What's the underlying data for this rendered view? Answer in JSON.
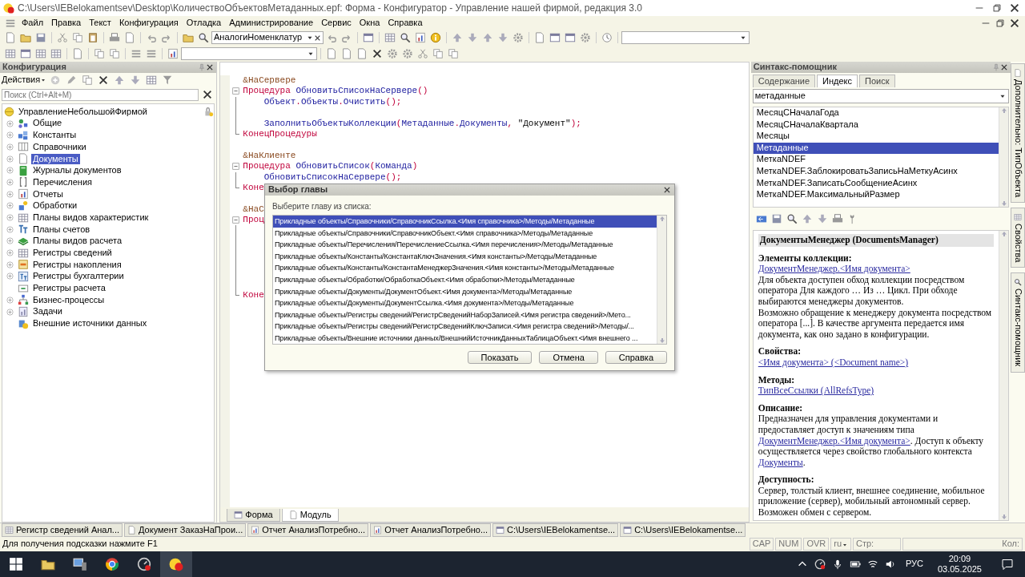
{
  "window": {
    "title": "C:\\Users\\IEBelokamentsev\\Desktop\\КоличествоОбъектовМетаданных.epf: Форма - Конфигуратор - Управление нашей фирмой, редакция 3.0"
  },
  "menu": [
    "Файл",
    "Правка",
    "Текст",
    "Конфигурация",
    "Отладка",
    "Администрирование",
    "Сервис",
    "Окна",
    "Справка"
  ],
  "toolbar": {
    "search_value": "АналогиНоменклатур"
  },
  "config_panel": {
    "title": "Конфигурация",
    "actions_label": "Действия",
    "search": {
      "placeholder": "Поиск (Ctrl+Alt+M)"
    },
    "tree": [
      {
        "label": "УправлениеНебольшойФирмой",
        "selected": false,
        "children": [
          {
            "label": "Общие",
            "expandable": true,
            "selected": false
          },
          {
            "label": "Константы",
            "expandable": true,
            "selected": false
          },
          {
            "label": "Справочники",
            "expandable": true,
            "selected": false
          },
          {
            "label": "Документы",
            "expandable": true,
            "selected": true
          },
          {
            "label": "Журналы документов",
            "expandable": true,
            "selected": false
          },
          {
            "label": "Перечисления",
            "expandable": true,
            "selected": false
          },
          {
            "label": "Отчеты",
            "expandable": true,
            "selected": false
          },
          {
            "label": "Обработки",
            "expandable": true,
            "selected": false
          },
          {
            "label": "Планы видов характеристик",
            "expandable": true,
            "selected": false
          },
          {
            "label": "Планы счетов",
            "expandable": true,
            "selected": false
          },
          {
            "label": "Планы видов расчета",
            "expandable": true,
            "selected": false
          },
          {
            "label": "Регистры сведений",
            "expandable": true,
            "selected": false
          },
          {
            "label": "Регистры накопления",
            "expandable": true,
            "selected": false
          },
          {
            "label": "Регистры бухгалтерии",
            "expandable": true,
            "selected": false
          },
          {
            "label": "Регистры расчета",
            "expandable": false,
            "selected": false
          },
          {
            "label": "Бизнес-процессы",
            "expandable": true,
            "selected": false
          },
          {
            "label": "Задачи",
            "expandable": true,
            "selected": false
          },
          {
            "label": "Внешние источники данных",
            "expandable": false,
            "selected": false
          }
        ]
      }
    ]
  },
  "editor": {
    "lines": [
      {
        "kind": "code",
        "fold_start": false,
        "in_fold": false,
        "fold_end": false,
        "indented": false,
        "tokens": [
          {
            "kind": "directive",
            "text": "&НаСервере"
          }
        ]
      },
      {
        "kind": "code",
        "fold_start": true,
        "in_fold": false,
        "fold_end": false,
        "indented": false,
        "tokens": [
          {
            "kind": "keyword",
            "text": "Процедура "
          },
          {
            "kind": "ident",
            "text": "ОбновитьСписокНаСервере"
          },
          {
            "kind": "punct",
            "text": "()"
          }
        ]
      },
      {
        "kind": "code",
        "fold_start": false,
        "in_fold": true,
        "fold_end": false,
        "indented": true,
        "tokens": [
          {
            "kind": "ident",
            "text": "Объект"
          },
          {
            "kind": "punct",
            "text": "."
          },
          {
            "kind": "ident",
            "text": "Объекты"
          },
          {
            "kind": "punct",
            "text": "."
          },
          {
            "kind": "ident",
            "text": "Очистить"
          },
          {
            "kind": "punct",
            "text": "();"
          }
        ]
      },
      {
        "kind": "blank",
        "fold_start": false,
        "in_fold": true,
        "fold_end": false
      },
      {
        "kind": "code",
        "fold_start": false,
        "in_fold": true,
        "fold_end": false,
        "indented": true,
        "tokens": [
          {
            "kind": "ident",
            "text": "ЗаполнитьОбъектыКоллекции"
          },
          {
            "kind": "punct",
            "text": "("
          },
          {
            "kind": "ident",
            "text": "Метаданные"
          },
          {
            "kind": "punct",
            "text": "."
          },
          {
            "kind": "ident",
            "text": "Документы"
          },
          {
            "kind": "punct",
            "text": ", "
          },
          {
            "kind": "string",
            "text": "\"Документ\""
          },
          {
            "kind": "punct",
            "text": ");"
          }
        ]
      },
      {
        "kind": "code",
        "fold_start": false,
        "in_fold": false,
        "fold_end": true,
        "indented": false,
        "tokens": [
          {
            "kind": "keyword",
            "text": "КонецПроцедуры"
          }
        ]
      },
      {
        "kind": "blank",
        "fold_start": false,
        "in_fold": false,
        "fold_end": false
      },
      {
        "kind": "code",
        "fold_start": false,
        "in_fold": false,
        "fold_end": false,
        "indented": false,
        "tokens": [
          {
            "kind": "directive",
            "text": "&НаКлиенте"
          }
        ]
      },
      {
        "kind": "code",
        "fold_start": true,
        "in_fold": false,
        "fold_end": false,
        "indented": false,
        "tokens": [
          {
            "kind": "keyword",
            "text": "Процедура "
          },
          {
            "kind": "ident",
            "text": "ОбновитьСписок"
          },
          {
            "kind": "punct",
            "text": "("
          },
          {
            "kind": "ident",
            "text": "Команда"
          },
          {
            "kind": "punct",
            "text": ")"
          }
        ]
      },
      {
        "kind": "code",
        "fold_start": false,
        "in_fold": true,
        "fold_end": false,
        "indented": true,
        "tokens": [
          {
            "kind": "ident",
            "text": "ОбновитьСписокНаСервере"
          },
          {
            "kind": "punct",
            "text": "();"
          }
        ]
      },
      {
        "kind": "code",
        "fold_start": false,
        "in_fold": false,
        "fold_end": true,
        "indented": false,
        "tokens": [
          {
            "kind": "keyword",
            "text": "Коне"
          }
        ]
      },
      {
        "kind": "blank",
        "fold_start": false,
        "in_fold": false,
        "fold_end": false
      },
      {
        "kind": "code",
        "fold_start": false,
        "in_fold": false,
        "fold_end": false,
        "indented": false,
        "tokens": [
          {
            "kind": "directive",
            "text": "&НаС"
          }
        ]
      },
      {
        "kind": "code",
        "fold_start": true,
        "in_fold": false,
        "fold_end": false,
        "indented": false,
        "tokens": [
          {
            "kind": "keyword",
            "text": "Проц"
          }
        ]
      },
      {
        "kind": "blank",
        "fold_start": false,
        "in_fold": true,
        "fold_end": false
      },
      {
        "kind": "blank",
        "fold_start": false,
        "in_fold": true,
        "fold_end": false
      },
      {
        "kind": "blank",
        "fold_start": false,
        "in_fold": true,
        "fold_end": false
      },
      {
        "kind": "blank",
        "fold_start": false,
        "in_fold": true,
        "fold_end": false
      },
      {
        "kind": "blank",
        "fold_start": false,
        "in_fold": true,
        "fold_end": false
      },
      {
        "kind": "blank",
        "fold_start": false,
        "in_fold": true,
        "fold_end": false
      },
      {
        "kind": "code",
        "fold_start": false,
        "in_fold": false,
        "fold_end": true,
        "indented": false,
        "tokens": [
          {
            "kind": "keyword",
            "text": "Коне"
          }
        ]
      }
    ],
    "tabs": [
      {
        "label": "Форма",
        "selected": false
      },
      {
        "label": "Модуль",
        "selected": true
      }
    ]
  },
  "dialog": {
    "title": "Выбор главы",
    "prompt": "Выберите главу из списка:",
    "items": [
      {
        "text": "Прикладные объекты/Справочники/СправочникСсылка.<Имя справочника>/Методы/Метаданные",
        "selected": true
      },
      {
        "text": "Прикладные объекты/Справочники/СправочникОбъект.<Имя справочника>/Методы/Метаданные",
        "selected": false
      },
      {
        "text": "Прикладные объекты/Перечисления/ПеречислениеСсылка.<Имя перечисления>/Методы/Метаданные",
        "selected": false
      },
      {
        "text": "Прикладные объекты/Константы/КонстантаКлючЗначения.<Имя константы>/Методы/Метаданные",
        "selected": false
      },
      {
        "text": "Прикладные объекты/Константы/КонстантаМенеджерЗначения.<Имя константы>/Методы/Метаданные",
        "selected": false
      },
      {
        "text": "Прикладные объекты/Обработки/ОбработкаОбъект.<Имя обработки>/Методы/Метаданные",
        "selected": false
      },
      {
        "text": "Прикладные объекты/Документы/ДокументОбъект.<Имя документа>/Методы/Метаданные",
        "selected": false
      },
      {
        "text": "Прикладные объекты/Документы/ДокументСсылка.<Имя документа>/Методы/Метаданные",
        "selected": false
      },
      {
        "text": "Прикладные объекты/Регистры сведений/РегистрСведенийНаборЗаписей.<Имя регистра сведений>/Мето...",
        "selected": false
      },
      {
        "text": "Прикладные объекты/Регистры сведений/РегистрСведенийКлючЗаписи.<Имя регистра сведений>/Методы/...",
        "selected": false
      },
      {
        "text": "Прикладные объекты/Внешние источники данных/ВнешнийИсточникДанныхТаблицаОбъект.<Имя внешнего ...",
        "selected": false
      }
    ],
    "buttons": [
      "Показать",
      "Отмена",
      "Справка"
    ]
  },
  "help": {
    "title": "Синтакс-помощник",
    "tabs": [
      {
        "label": "Содержание",
        "selected": false
      },
      {
        "label": "Индекс",
        "selected": true
      },
      {
        "label": "Поиск",
        "selected": false
      }
    ],
    "search_value": "метаданные",
    "index": [
      {
        "text": "МесяцСНачалаГода",
        "selected": false
      },
      {
        "text": "МесяцСНачалаКвартала",
        "selected": false
      },
      {
        "text": "Месяцы",
        "selected": false
      },
      {
        "text": "Метаданные",
        "selected": true
      },
      {
        "text": "МеткаNDEF",
        "selected": false
      },
      {
        "text": "МеткаNDEF.ЗаблокироватьЗаписьНаМеткуАсинх",
        "selected": false
      },
      {
        "text": "МеткаNDEF.ЗаписатьСообщениеАсинх",
        "selected": false
      },
      {
        "text": "МеткаNDEF.МаксимальныйРазмер",
        "selected": false
      }
    ],
    "topic": "ДокументыМенеджер (DocumentsManager)",
    "sections": [
      {
        "title": "Элементы коллекции:",
        "blocks": [
          {
            "kind": "link",
            "text": "ДокументМенеджер.<Имя документа>"
          },
          {
            "kind": "text",
            "parts": [
              {
                "text": "Для объекта доступен обход коллекции посредством оператора Для каждого … Из … Цикл. При обходе выбираются менеджеры документов.",
                "link": false
              }
            ]
          },
          {
            "kind": "text",
            "parts": [
              {
                "text": "Возможно обращение к менеджеру документа посредством оператора [...]. В качестве аргумента передается имя документа, как оно задано в конфигурации.",
                "link": false
              }
            ]
          }
        ]
      },
      {
        "title": "Свойства:",
        "blocks": [
          {
            "kind": "link",
            "text": "<Имя документа> (<Document name>)"
          }
        ]
      },
      {
        "title": "Методы:",
        "blocks": [
          {
            "kind": "link",
            "text": "ТипВсеСсылки (AllRefsType)"
          }
        ]
      },
      {
        "title": "Описание:",
        "blocks": [
          {
            "kind": "text",
            "parts": [
              {
                "text": "Предназначен для управления документами и предоставляет доступ к значениям типа ",
                "link": false
              },
              {
                "text": "ДокументМенеджер.<Имя документа>",
                "link": true
              },
              {
                "text": ". Доступ к объекту осуществляется через свойство глобального контекста ",
                "link": false
              },
              {
                "text": "Документы",
                "link": true
              },
              {
                "text": ".",
                "link": false
              }
            ]
          }
        ]
      },
      {
        "title": "Доступность:",
        "blocks": [
          {
            "kind": "text",
            "parts": [
              {
                "text": "Сервер, толстый клиент, внешнее соединение, мобильное приложение (сервер), мобильный автономный сервер. Возможен обмен с сервером.",
                "link": false
              }
            ]
          }
        ]
      }
    ]
  },
  "side_tabs": [
    "Дополнительно: ТипОбъекта",
    "Свойства",
    "Синтакс-помощник"
  ],
  "open_windows": [
    "Регистр сведений Анал...",
    "Документ ЗаказНаПрои...",
    "Отчет АнализПотребно...",
    "Отчет АнализПотребно...",
    "C:\\Users\\IEBelokamentse...",
    "C:\\Users\\IEBelokamentse..."
  ],
  "status_bar": {
    "hint": "Для получения подсказки нажмите F1",
    "indicators": [
      "CAP",
      "NUM",
      "OVR"
    ],
    "language": "ru",
    "row_label": "Стр:",
    "col_label": "Кол:"
  },
  "taskbar": {
    "tray_language": "РУС",
    "time": "20:09",
    "date": "03.05.2025"
  }
}
